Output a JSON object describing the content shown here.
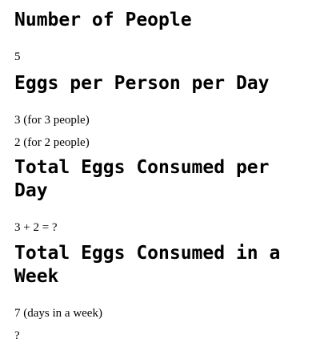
{
  "sections": [
    {
      "title": "Number of People",
      "lines": [
        "5"
      ]
    },
    {
      "title": "Eggs per Person per Day",
      "lines": [
        "3 (for 3 people)",
        "2 (for 2 people)"
      ]
    },
    {
      "title": "Total Eggs Consumed per Day",
      "lines": [
        "3 + 2 = ?"
      ]
    },
    {
      "title": "Total Eggs Consumed in a Week",
      "lines": [
        "7 (days in a week)",
        "?"
      ]
    }
  ]
}
